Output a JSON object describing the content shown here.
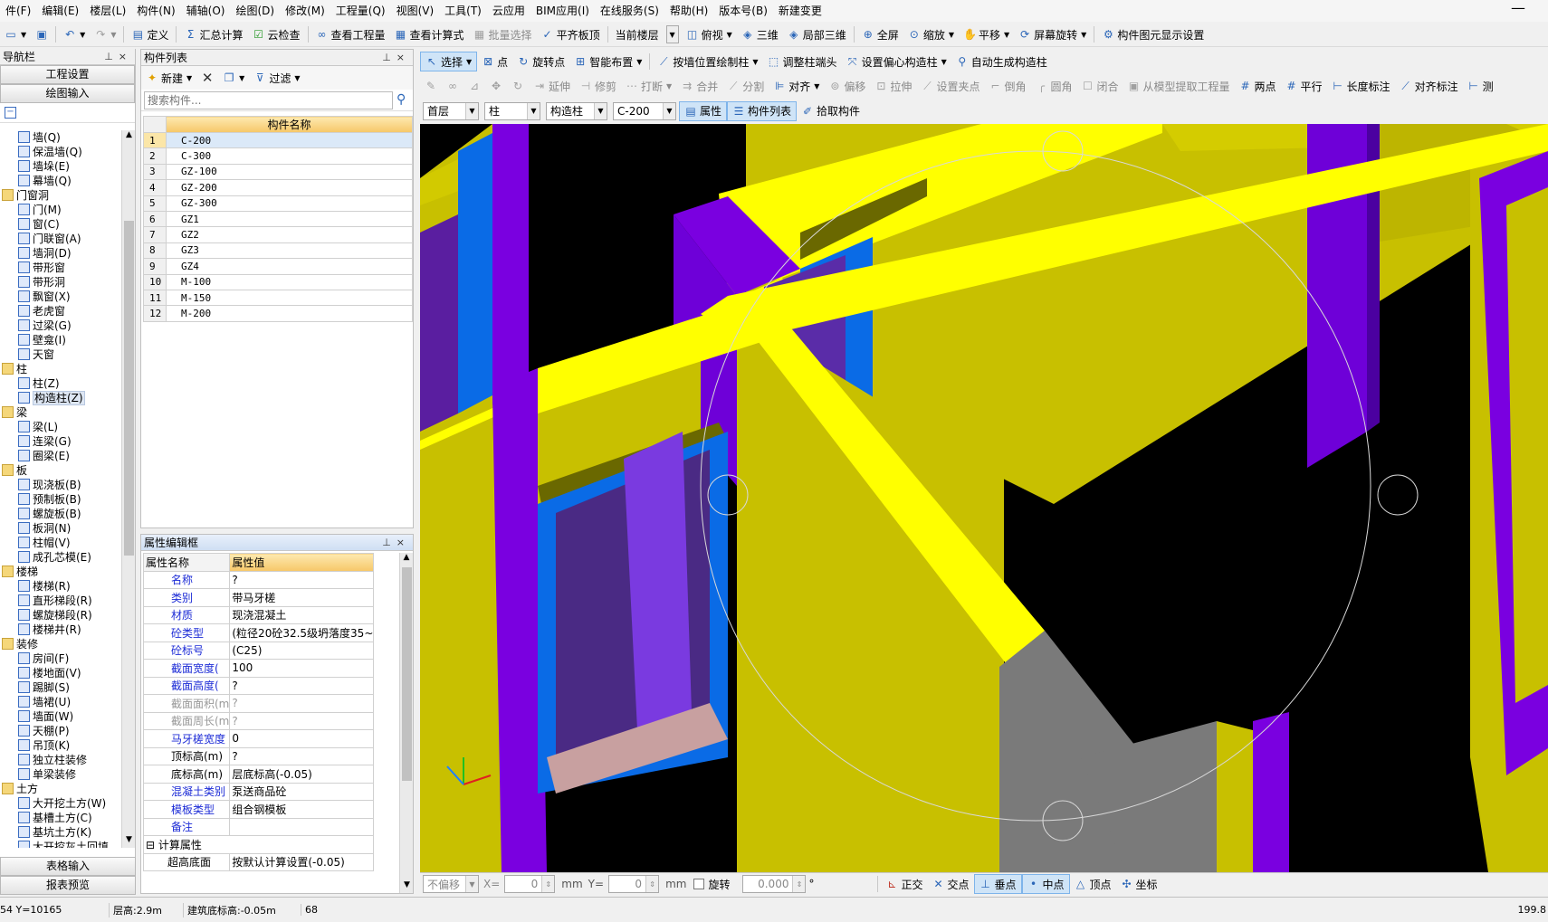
{
  "menu": [
    "件(F)",
    "编辑(E)",
    "楼层(L)",
    "构件(N)",
    "辅轴(O)",
    "绘图(D)",
    "修改(M)",
    "工程量(Q)",
    "视图(V)",
    "工具(T)",
    "云应用",
    "BIM应用(I)",
    "在线服务(S)",
    "帮助(H)",
    "版本号(B)",
    "新建变更"
  ],
  "toolbar1": {
    "define": "定义",
    "calc": "汇总计算",
    "cloud_check": "云检查",
    "view_qty": "查看工程量",
    "view_formula": "查看计算式",
    "batch_select": "批量选择",
    "flush_slab": "平齐板顶",
    "current_floor": "当前楼层",
    "top_view": "俯视",
    "view3d": "三维",
    "local3d": "局部三维",
    "fullscreen": "全屏",
    "zoom": "缩放",
    "pan": "平移",
    "screen_rotate": "屏幕旋转",
    "display_settings": "构件图元显示设置"
  },
  "toolbar2": {
    "select": "选择",
    "point": "点",
    "rotate_point": "旋转点",
    "smart_layout": "智能布置",
    "draw_by_wall": "按墙位置绘制柱",
    "adjust_col_end": "调整柱端头",
    "set_offset": "设置偏心构造柱",
    "auto_gen": "自动生成构造柱"
  },
  "toolbar3": {
    "extend": "延伸",
    "trim": "修剪",
    "break": "打断",
    "merge": "合并",
    "split": "分割",
    "align": "对齐",
    "offset": "偏移",
    "stretch": "拉伸",
    "set_grip": "设置夹点",
    "chamfer": "倒角",
    "fillet": "圆角",
    "close": "闭合",
    "extract": "从模型提取工程量",
    "two_point": "两点",
    "parallel": "平行",
    "length_dim": "长度标注",
    "align_dim": "对齐标注",
    "measure": "测"
  },
  "toolbar4": {
    "floor": "首层",
    "category": "柱",
    "type": "构造柱",
    "component": "C-200",
    "properties": "属性",
    "comp_list": "构件列表",
    "pick": "拾取构件"
  },
  "nav": {
    "title": "导航栏",
    "project_settings": "工程设置",
    "draw_input": "绘图输入",
    "table_input": "表格输入",
    "report_preview": "报表预览",
    "tree": [
      {
        "label": "墙(Q)",
        "level": 1
      },
      {
        "label": "保温墙(Q)",
        "level": 1
      },
      {
        "label": "墙垛(E)",
        "level": 1
      },
      {
        "label": "幕墙(Q)",
        "level": 1
      },
      {
        "label": "门窗洞",
        "level": 0
      },
      {
        "label": "门(M)",
        "level": 1
      },
      {
        "label": "窗(C)",
        "level": 1
      },
      {
        "label": "门联窗(A)",
        "level": 1
      },
      {
        "label": "墙洞(D)",
        "level": 1
      },
      {
        "label": "带形窗",
        "level": 1
      },
      {
        "label": "带形洞",
        "level": 1
      },
      {
        "label": "飘窗(X)",
        "level": 1
      },
      {
        "label": "老虎窗",
        "level": 1
      },
      {
        "label": "过梁(G)",
        "level": 1
      },
      {
        "label": "壁龛(I)",
        "level": 1
      },
      {
        "label": "天窗",
        "level": 1
      },
      {
        "label": "柱",
        "level": 0
      },
      {
        "label": "柱(Z)",
        "level": 1
      },
      {
        "label": "构造柱(Z)",
        "level": 1,
        "selected": true
      },
      {
        "label": "梁",
        "level": 0
      },
      {
        "label": "梁(L)",
        "level": 1
      },
      {
        "label": "连梁(G)",
        "level": 1
      },
      {
        "label": "圈梁(E)",
        "level": 1
      },
      {
        "label": "板",
        "level": 0
      },
      {
        "label": "现浇板(B)",
        "level": 1
      },
      {
        "label": "预制板(B)",
        "level": 1
      },
      {
        "label": "螺旋板(B)",
        "level": 1
      },
      {
        "label": "板洞(N)",
        "level": 1
      },
      {
        "label": "柱帽(V)",
        "level": 1
      },
      {
        "label": "成孔芯模(E)",
        "level": 1
      },
      {
        "label": "楼梯",
        "level": 0
      },
      {
        "label": "楼梯(R)",
        "level": 1
      },
      {
        "label": "直形梯段(R)",
        "level": 1
      },
      {
        "label": "螺旋梯段(R)",
        "level": 1
      },
      {
        "label": "楼梯井(R)",
        "level": 1
      },
      {
        "label": "装修",
        "level": 0
      },
      {
        "label": "房间(F)",
        "level": 1
      },
      {
        "label": "楼地面(V)",
        "level": 1
      },
      {
        "label": "踢脚(S)",
        "level": 1
      },
      {
        "label": "墙裙(U)",
        "level": 1
      },
      {
        "label": "墙面(W)",
        "level": 1
      },
      {
        "label": "天棚(P)",
        "level": 1
      },
      {
        "label": "吊顶(K)",
        "level": 1
      },
      {
        "label": "独立柱装修",
        "level": 1
      },
      {
        "label": "单梁装修",
        "level": 1
      },
      {
        "label": "土方",
        "level": 0
      },
      {
        "label": "大开挖土方(W)",
        "level": 1
      },
      {
        "label": "基槽土方(C)",
        "level": 1
      },
      {
        "label": "基坑土方(K)",
        "level": 1
      },
      {
        "label": "大开挖灰土回填",
        "level": 1
      }
    ]
  },
  "complist": {
    "title": "构件列表",
    "new": "新建",
    "filter": "过滤",
    "search_placeholder": "搜索构件...",
    "header": "构件名称",
    "rows": [
      {
        "n": "1",
        "name": "C-200",
        "selected": true
      },
      {
        "n": "2",
        "name": "C-300"
      },
      {
        "n": "3",
        "name": "GZ-100"
      },
      {
        "n": "4",
        "name": "GZ-200"
      },
      {
        "n": "5",
        "name": "GZ-300"
      },
      {
        "n": "6",
        "name": "GZ1"
      },
      {
        "n": "7",
        "name": "GZ2"
      },
      {
        "n": "8",
        "name": "GZ3"
      },
      {
        "n": "9",
        "name": "GZ4"
      },
      {
        "n": "10",
        "name": "M-100"
      },
      {
        "n": "11",
        "name": "M-150"
      },
      {
        "n": "12",
        "name": "M-200"
      }
    ]
  },
  "props": {
    "title": "属性编辑框",
    "h_name": "属性名称",
    "h_value": "属性值",
    "rows": [
      {
        "k": "名称",
        "v": "?",
        "kc": "blue"
      },
      {
        "k": "类别",
        "v": "带马牙槎",
        "kc": "blue"
      },
      {
        "k": "材质",
        "v": "现浇混凝土",
        "kc": "blue"
      },
      {
        "k": "砼类型",
        "v": "(粒径20砼32.5级坍落度35~",
        "kc": "blue"
      },
      {
        "k": "砼标号",
        "v": "(C25)",
        "kc": "blue"
      },
      {
        "k": "截面宽度(",
        "v": "100",
        "kc": "blue"
      },
      {
        "k": "截面高度(",
        "v": "?",
        "kc": "blue"
      },
      {
        "k": "截面面积(m",
        "v": "?",
        "kc": "gray"
      },
      {
        "k": "截面周长(m",
        "v": "?",
        "kc": "gray"
      },
      {
        "k": "马牙槎宽度",
        "v": "0",
        "kc": "blue"
      },
      {
        "k": "顶标高(m)",
        "v": "?",
        "kc": "black"
      },
      {
        "k": "底标高(m)",
        "v": "层底标高(-0.05)",
        "kc": "black"
      },
      {
        "k": "混凝土类别",
        "v": "泵送商品砼",
        "kc": "blue"
      },
      {
        "k": "模板类型",
        "v": "组合钢模板",
        "kc": "blue"
      },
      {
        "k": "备注",
        "v": "",
        "kc": "blue"
      }
    ],
    "group": "计算属性",
    "sub_k": "超高底面",
    "sub_v": "按默认计算设置(-0.05)"
  },
  "coordbar": {
    "no_offset": "不偏移",
    "x_label": "X=",
    "x_val": "0",
    "unit1": "mm",
    "y_label": "Y=",
    "y_val": "0",
    "unit2": "mm",
    "rotate": "旋转",
    "angle": "0.000",
    "deg": "°"
  },
  "snap": {
    "ortho": "正交",
    "intersect": "交点",
    "perp": "垂点",
    "mid": "中点",
    "vertex": "顶点",
    "coord": "坐标"
  },
  "status": {
    "coord": "54 Y=10165",
    "floor_h": "层高:2.9m",
    "base_elev": "建筑底标高:-0.05m",
    "count": "68",
    "right": "199.8"
  },
  "colors": {
    "yellow": "#c8c000",
    "bright_yellow": "#ffff00",
    "purple": "#7a00e0",
    "blue": "#0a6be6",
    "gray": "#7a7a7a"
  }
}
